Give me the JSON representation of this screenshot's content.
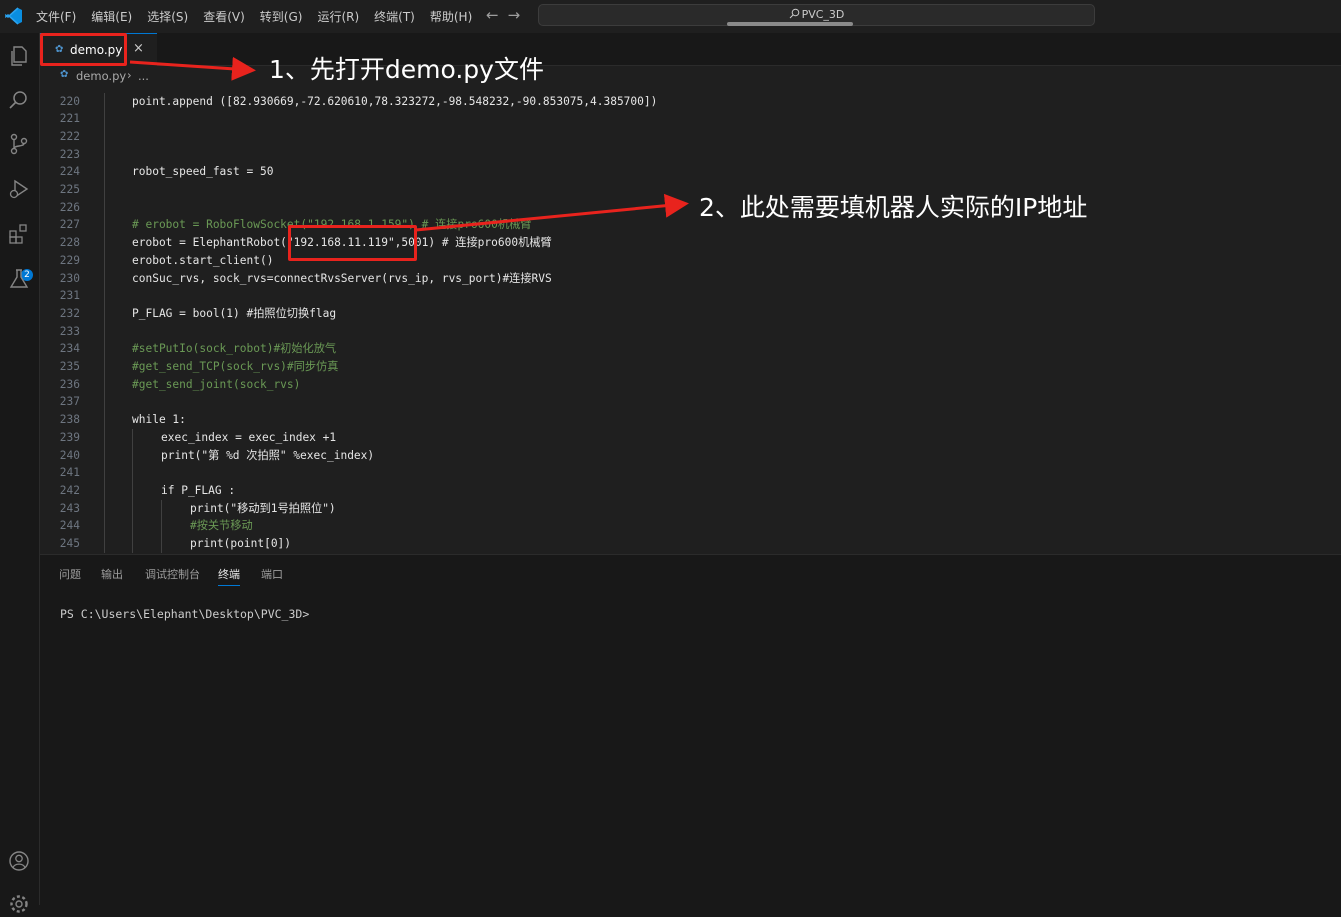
{
  "menu": [
    "文件(F)",
    "编辑(E)",
    "选择(S)",
    "查看(V)",
    "转到(G)",
    "运行(R)",
    "终端(T)",
    "帮助(H)"
  ],
  "nav": {
    "back": "←",
    "forward": "→"
  },
  "search": {
    "text": "PVC_3D"
  },
  "tab": {
    "label": "demo.py",
    "close": "×"
  },
  "breadcrumb": {
    "file": "demo.py",
    "sep": "›",
    "more": "..."
  },
  "editor": {
    "lines": [
      {
        "n": "220",
        "indent": 0,
        "text": "point.append ([82.930669,-72.620610,78.323272,-98.548232,-90.853075,4.385700])"
      },
      {
        "n": "221",
        "indent": 0,
        "text": ""
      },
      {
        "n": "222",
        "indent": 0,
        "text": ""
      },
      {
        "n": "223",
        "indent": 0,
        "text": ""
      },
      {
        "n": "224",
        "indent": 0,
        "text": "robot_speed_fast = 50"
      },
      {
        "n": "225",
        "indent": 0,
        "text": ""
      },
      {
        "n": "226",
        "indent": 0,
        "text": ""
      },
      {
        "n": "227",
        "indent": 0,
        "text": "# erobot = RoboFlowSocket(\"192.168.1.159\") # 连接pro600机械臂",
        "comment": true
      },
      {
        "n": "228",
        "indent": 0,
        "text": "erobot = ElephantRobot(\"192.168.11.119\",5001) # 连接pro600机械臂"
      },
      {
        "n": "229",
        "indent": 0,
        "text": "erobot.start_client()"
      },
      {
        "n": "230",
        "indent": 0,
        "text": "conSuc_rvs, sock_rvs=connectRvsServer(rvs_ip, rvs_port)#连接RVS"
      },
      {
        "n": "231",
        "indent": 0,
        "text": ""
      },
      {
        "n": "232",
        "indent": 0,
        "text": "P_FLAG = bool(1) #拍照位切换flag"
      },
      {
        "n": "233",
        "indent": 0,
        "text": ""
      },
      {
        "n": "234",
        "indent": 0,
        "text": "#setPutIo(sock_robot)#初始化放气",
        "comment": true
      },
      {
        "n": "235",
        "indent": 0,
        "text": "#get_send_TCP(sock_rvs)#同步仿真",
        "comment": true
      },
      {
        "n": "236",
        "indent": 0,
        "text": "#get_send_joint(sock_rvs)",
        "comment": true
      },
      {
        "n": "237",
        "indent": 0,
        "text": ""
      },
      {
        "n": "238",
        "indent": 0,
        "text": "while 1:"
      },
      {
        "n": "239",
        "indent": 1,
        "text": "exec_index = exec_index +1"
      },
      {
        "n": "240",
        "indent": 1,
        "text": "print(\"第 %d 次拍照\" %exec_index)"
      },
      {
        "n": "241",
        "indent": 1,
        "text": ""
      },
      {
        "n": "242",
        "indent": 1,
        "text": "if P_FLAG :"
      },
      {
        "n": "243",
        "indent": 2,
        "text": "print(\"移动到1号拍照位\")"
      },
      {
        "n": "244",
        "indent": 2,
        "text": "#按关节移动",
        "comment": true
      },
      {
        "n": "245",
        "indent": 2,
        "text": "print(point[0])"
      }
    ]
  },
  "panel": {
    "tabs": [
      "问题",
      "输出",
      "调试控制台",
      "终端",
      "端口"
    ],
    "active_tab": "终端",
    "terminal_prompt": "PS C:\\Users\\Elephant\\Desktop\\PVC_3D>"
  },
  "annotations": {
    "step1": "1、先打开demo.py文件",
    "step2": "2、此处需要填机器人实际的IP地址",
    "color": "#e8231d"
  },
  "colors": {
    "accent": "#0078d4",
    "editor_bg": "#1f1f1f",
    "comment": "#6a9955"
  },
  "activity_bar": [
    "explorer-icon",
    "search-icon",
    "source-control-icon",
    "run-debug-icon",
    "extensions-icon",
    "testing-icon",
    "account-icon",
    "settings-gear-icon"
  ],
  "extensions_badge": "2"
}
